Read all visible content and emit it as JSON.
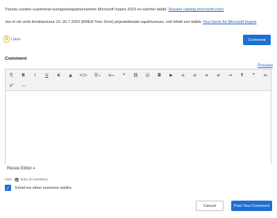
{
  "intro": {
    "line1_text": "Tutustu vuoden suurimman kumppanitapahtumamme Microsoft Inspire 2023 eri osioihin täältä: ",
    "line1_link": "Session catalog (microsoft.com)",
    "line2_text": "Jos et ole vielä ilmoittautunut 19.-20.7.2023 (EMEA Time Zone) järjestettävään tapahtumaan, voit tehdä sen täältä: ",
    "line2_link": "Your home for Microsoft Inspire"
  },
  "likes": {
    "count": "0",
    "label": "Likes"
  },
  "top_comment_button": "Comment",
  "comment_section": {
    "title": "Comment",
    "preview_label": "Preview"
  },
  "toolbar": {
    "row1": [
      {
        "name": "paste-icon",
        "glyph": "⎘"
      },
      {
        "name": "bold-icon",
        "glyph": "B"
      },
      {
        "name": "italic-icon",
        "glyph": "I"
      },
      {
        "name": "underline-icon",
        "glyph": "U"
      },
      {
        "name": "strikethrough-icon",
        "glyph": "S"
      },
      {
        "name": "warning-icon",
        "glyph": "▲"
      },
      {
        "name": "code-icon",
        "glyph": "</>"
      },
      {
        "name": "bullet-list-icon",
        "glyph": "☰"
      },
      {
        "name": "numbered-list-icon",
        "glyph": "≡"
      },
      {
        "name": "quote-icon",
        "glyph": "❝"
      },
      {
        "name": "link-icon",
        "glyph": "⛓"
      },
      {
        "name": "emoji-icon",
        "glyph": "☺"
      },
      {
        "name": "camera-icon",
        "glyph": "◘"
      },
      {
        "name": "video-icon",
        "glyph": "▶"
      },
      {
        "name": "align-left-icon",
        "glyph": "≡"
      },
      {
        "name": "align-center-icon",
        "glyph": "≡"
      },
      {
        "name": "align-right-icon",
        "glyph": "≡"
      },
      {
        "name": "justify-icon",
        "glyph": "≡"
      },
      {
        "name": "indent-icon",
        "glyph": "⇥"
      },
      {
        "name": "paragraph-icon",
        "glyph": "¶"
      },
      {
        "name": "blockquote-icon",
        "glyph": "❞"
      },
      {
        "name": "subscript-icon",
        "glyph": "x₂"
      }
    ],
    "row2": [
      {
        "name": "superscript-icon",
        "glyph": "x²"
      },
      {
        "name": "horizontal-rule-icon",
        "glyph": "—"
      }
    ]
  },
  "resize_editor_label": "Resize Editor",
  "hint": {
    "label": "Hint:",
    "text": "links to members"
  },
  "email_option": {
    "label": "Email me when someone replies",
    "checked": true
  },
  "actions": {
    "cancel": "Cancel",
    "post": "Post Your Comment"
  },
  "colors": {
    "accent": "#1f6fd1",
    "like_outline": "#f2b600"
  }
}
